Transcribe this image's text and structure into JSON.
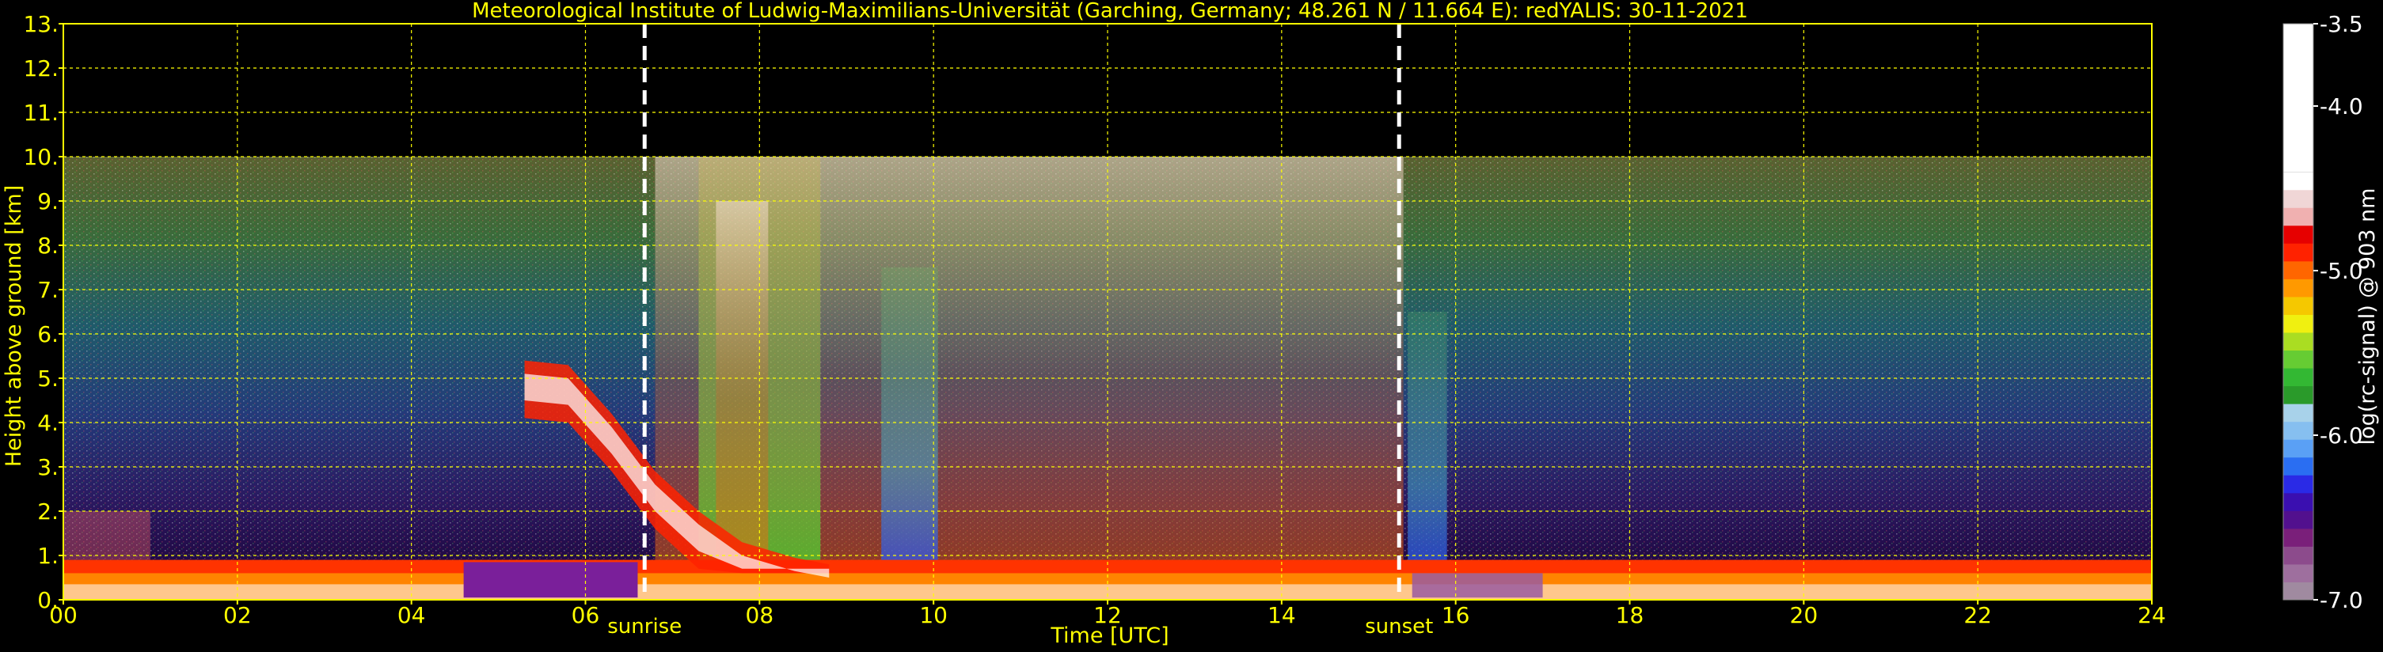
{
  "chart_data": {
    "type": "heatmap",
    "title": "Meteorological Institute of Ludwig-Maximilians-Universität (Garching, Germany; 48.261 N / 11.664 E):    redYALIS: 30-11-2021",
    "xlabel": "Time [UTC]",
    "ylabel": "Height above ground [km]",
    "xlim": [
      0,
      24
    ],
    "ylim": [
      0,
      13
    ],
    "x_ticks": [
      "00",
      "02",
      "04",
      "06",
      "08",
      "10",
      "12",
      "14",
      "16",
      "18",
      "20",
      "22",
      "24"
    ],
    "y_ticks": [
      "0.",
      "1.",
      "2.",
      "3.",
      "4.",
      "5.",
      "6.",
      "7.",
      "8.",
      "9.",
      "10.",
      "11.",
      "12.",
      "13."
    ],
    "grid": true,
    "grid_color": "#ffff00",
    "data_top_height_km": 10,
    "annotations": [
      {
        "label": "sunrise",
        "x": 6.68
      },
      {
        "label": "sunset",
        "x": 15.35
      }
    ],
    "colorbar": {
      "label": "log(rc-signal) @ 903 nm",
      "range": [
        -7.0,
        -3.5
      ],
      "tick_labels": [
        "-3.5",
        "-4.0",
        "-5.0",
        "-6.0",
        "-7.0"
      ],
      "tick_values": [
        -3.5,
        -4.0,
        -5.0,
        -6.0,
        -7.0
      ],
      "colors": [
        "#a08aa0",
        "#9e6f9e",
        "#8c4b8c",
        "#7a1f7a",
        "#52108e",
        "#3a0fb0",
        "#2a2ae6",
        "#2a6ef2",
        "#5aa0f5",
        "#86bff0",
        "#a8d2ea",
        "#2a9a2a",
        "#33b833",
        "#66cc33",
        "#aadd22",
        "#f0f010",
        "#f5c800",
        "#ff9900",
        "#ff6600",
        "#ff2200",
        "#e60000",
        "#f0b0b0",
        "#f0d6d6",
        "#ffffff"
      ]
    },
    "features": [
      {
        "name": "boundary layer",
        "x_start": 0,
        "x_end": 24,
        "height_km": [
          0.0,
          0.9
        ]
      },
      {
        "name": "aerosol/cloud layer descending",
        "x_start": 5.3,
        "x_end": 8.8,
        "height_km_start": 5.4,
        "height_km_end": 0.7
      },
      {
        "name": "noise / daylight background",
        "x_start": 6.8,
        "x_end": 15.5,
        "height_km": [
          0,
          10
        ]
      }
    ]
  }
}
